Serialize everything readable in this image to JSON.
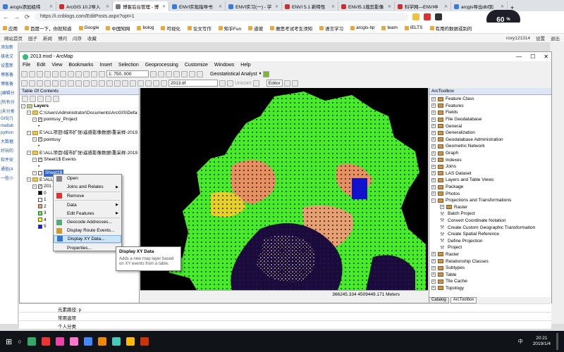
{
  "browser": {
    "tabs": [
      {
        "label": "arcgis添加经纬",
        "color": "#3a7bd5"
      },
      {
        "label": "ArcGIS 10.2导入",
        "color": "#c9302c"
      },
      {
        "label": "博客后台管理 - 博",
        "color": "#777777"
      },
      {
        "label": "ENVI实现指导书",
        "color": "#3a7bd5"
      },
      {
        "label": "ENVI实习(一) - 学",
        "color": "#3a7bd5"
      },
      {
        "label": "ENVI 5.1 新特性",
        "color": "#c9302c"
      },
      {
        "label": "ENVI5.1裁剪影像",
        "color": "#c9302c"
      },
      {
        "label": "科学网—ENVI中",
        "color": "#c9302c"
      },
      {
        "label": "arcgis导出dbf到",
        "color": "#3a7bd5"
      }
    ],
    "new_tab": "+",
    "url": "https://i.cnblogs.com/EditPosts.aspx?opt=1",
    "speed": "60",
    "speed_unit": "%",
    "bookmarks": [
      "应用",
      "百度一下，你就知道",
      "Google",
      "中国知网",
      "bolog",
      "可视化",
      "论文写作",
      "知乎Fun",
      "道坡",
      "雅思考试考生须知",
      "语言学习",
      "arcgis-tip",
      "team",
      "IELTS",
      "有用的数据或别的"
    ]
  },
  "blog_bar": {
    "items": [
      "网站首页",
      "园子",
      "新闻",
      "博问",
      "闪存",
      "收藏"
    ],
    "user": "roxy121314",
    "settings": "设置",
    "logout": "退出"
  },
  "left_sidebar": [
    "添加新",
    "接收文",
    "设置新",
    "博客备",
    "博客备",
    "[编辑分",
    "[所有分",
    "[未分类",
    "GIS(7)",
    "matlab",
    "python",
    "大数据",
    "好玩的",
    "软件安",
    "通俗(4",
    "一些小"
  ],
  "arcmap": {
    "title": "2013.mxd - ArcMap",
    "menu": [
      "File",
      "Edit",
      "View",
      "Bookmarks",
      "Insert",
      "Selection",
      "Geoprocessing",
      "Customize",
      "Windows",
      "Help"
    ],
    "scale": "1: 750, 000",
    "geostat": "Geostatistical Analyst",
    "layer_select": "2013.tif",
    "unicom": "Unicom",
    "editor": "Editor",
    "toc": {
      "title": "Table Of Contents",
      "layers_label": "Layers",
      "rows": [
        {
          "text": "C:\\Users\\Administrator\\Documents\\ArcGIS\\Defau",
          "type": "folder",
          "indent": 1
        },
        {
          "text": "pointssy_Project",
          "type": "check",
          "indent": 2
        },
        {
          "text": "•",
          "type": "text",
          "indent": 3
        },
        {
          "text": "E:\\ALL项目\\城市扩张\\遥感影像数据\\重采样-2019",
          "type": "folder",
          "indent": 1
        },
        {
          "text": "pointssy",
          "type": "check",
          "indent": 2
        },
        {
          "text": "•",
          "type": "text",
          "indent": 3
        },
        {
          "text": "E:\\ALL项目\\城市扩张\\遥感影像数据\\重采样-2019",
          "type": "folder",
          "indent": 1
        },
        {
          "text": "Sheet1$ Events",
          "type": "check",
          "indent": 2
        },
        {
          "text": "•",
          "type": "text",
          "indent": 3
        },
        {
          "text": "Sheet1$",
          "type": "selected",
          "indent": 2
        },
        {
          "text": "E:\\ALLI",
          "type": "folder",
          "indent": 1
        },
        {
          "text": "201",
          "type": "check",
          "indent": 2
        },
        {
          "text": "0",
          "type": "legend",
          "indent": 3,
          "color": "#000000"
        },
        {
          "text": "1",
          "type": "legend",
          "indent": 3,
          "color": "#ffffff"
        },
        {
          "text": "2",
          "type": "legend",
          "indent": 3,
          "color": "#e8a070"
        },
        {
          "text": "3",
          "type": "legend",
          "indent": 3,
          "color": "#50ff30"
        },
        {
          "text": "4",
          "type": "legend",
          "indent": 3,
          "color": "#ffff00"
        },
        {
          "text": "5",
          "type": "legend",
          "indent": 3,
          "color": "#1010ff"
        }
      ]
    },
    "context_menu": [
      {
        "label": "Open",
        "icon": "open-icon",
        "arrow": false
      },
      {
        "label": "Joins and Relates",
        "icon": "",
        "arrow": true
      },
      {
        "label": "Remove",
        "icon": "remove-icon",
        "arrow": false
      },
      {
        "label": "Data",
        "icon": "",
        "arrow": true
      },
      {
        "label": "Edit Features",
        "icon": "",
        "arrow": true
      },
      {
        "label": "Geocode Addresses...",
        "icon": "geocode-icon",
        "arrow": false
      },
      {
        "label": "Display Route Events...",
        "icon": "route-icon",
        "arrow": false
      },
      {
        "label": "Display XY Data...",
        "icon": "xy-icon",
        "arrow": false
      },
      {
        "label": "Properties...",
        "icon": "",
        "arrow": false
      }
    ],
    "tooltip": {
      "title": "Display XY Data",
      "body": "Adds a new map layer based on XY events from a table."
    },
    "coords": "366245.334  4509449.171 Meters",
    "toolbox": {
      "title": "ArcToolbox",
      "items": [
        {
          "label": "Feature Class",
          "lvl": 0,
          "exp": "+"
        },
        {
          "label": "Features",
          "lvl": 0,
          "exp": "+"
        },
        {
          "label": "Fields",
          "lvl": 0,
          "exp": "+"
        },
        {
          "label": "File Geodatabase",
          "lvl": 0,
          "exp": "+"
        },
        {
          "label": "General",
          "lvl": 0,
          "exp": "+"
        },
        {
          "label": "Generalization",
          "lvl": 0,
          "exp": "+"
        },
        {
          "label": "Geodatabase Administration",
          "lvl": 0,
          "exp": "+"
        },
        {
          "label": "Geometric Network",
          "lvl": 0,
          "exp": "+"
        },
        {
          "label": "Graph",
          "lvl": 0,
          "exp": "+"
        },
        {
          "label": "Indexes",
          "lvl": 0,
          "exp": "+"
        },
        {
          "label": "Joins",
          "lvl": 0,
          "exp": "+"
        },
        {
          "label": "LAS Dataset",
          "lvl": 0,
          "exp": "+"
        },
        {
          "label": "Layers and Table Views",
          "lvl": 0,
          "exp": "+"
        },
        {
          "label": "Package",
          "lvl": 0,
          "exp": "+"
        },
        {
          "label": "Photos",
          "lvl": 0,
          "exp": "+"
        },
        {
          "label": "Projections and Transformations",
          "lvl": 0,
          "exp": "−"
        },
        {
          "label": "Raster",
          "lvl": 1,
          "exp": "+"
        },
        {
          "label": "Batch Project",
          "lvl": 1,
          "exp": ""
        },
        {
          "label": "Convert Coordinate Notation",
          "lvl": 1,
          "exp": ""
        },
        {
          "label": "Create Custom Geographic Transformation",
          "lvl": 1,
          "exp": ""
        },
        {
          "label": "Create Spatial Reference",
          "lvl": 1,
          "exp": ""
        },
        {
          "label": "Define Projection",
          "lvl": 1,
          "exp": ""
        },
        {
          "label": "Project",
          "lvl": 1,
          "exp": ""
        },
        {
          "label": "Raster",
          "lvl": 0,
          "exp": "+"
        },
        {
          "label": "Relationship Classes",
          "lvl": 0,
          "exp": "+"
        },
        {
          "label": "Subtypes",
          "lvl": 0,
          "exp": "+"
        },
        {
          "label": "Table",
          "lvl": 0,
          "exp": "+"
        },
        {
          "label": "Tile Cache",
          "lvl": 0,
          "exp": "+"
        },
        {
          "label": "Topology",
          "lvl": 0,
          "exp": "+"
        }
      ],
      "tabs": [
        "Catalog",
        "ArcToolbox"
      ]
    }
  },
  "page_below": {
    "rows": [
      "元素路径: p",
      "常用选项",
      "个人分类"
    ]
  },
  "taskbar": {
    "time": "20:21",
    "date": "2019/1/4",
    "lang": "中"
  }
}
